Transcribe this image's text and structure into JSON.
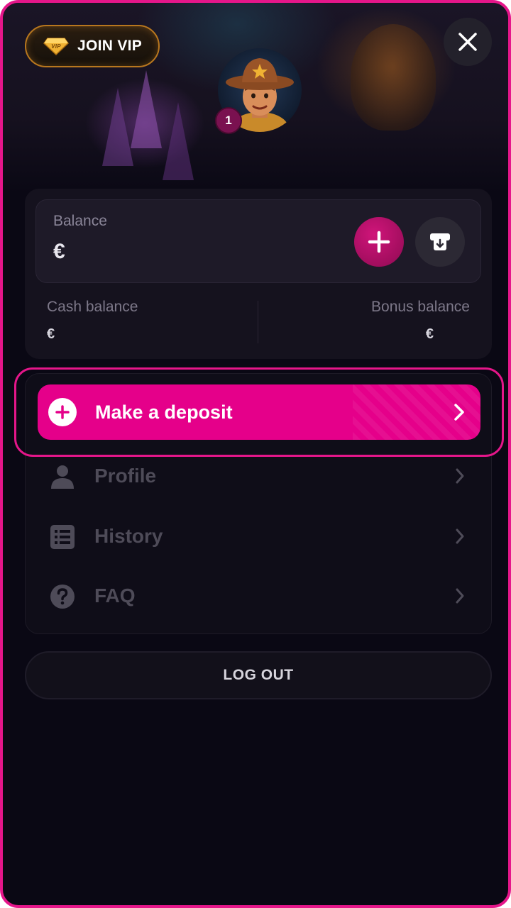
{
  "header": {
    "vip_button_label": "JOIN VIP",
    "vip_badge_text": "VIP",
    "level": "1"
  },
  "balance": {
    "label": "Balance",
    "value": "€",
    "cash_label": "Cash balance",
    "cash_value": "€",
    "bonus_label": "Bonus balance",
    "bonus_value": "€"
  },
  "menu": {
    "deposit_label": "Make a deposit",
    "items": [
      {
        "label": "Profile",
        "icon": "user-icon"
      },
      {
        "label": "History",
        "icon": "list-icon"
      },
      {
        "label": "FAQ",
        "icon": "question-icon"
      }
    ]
  },
  "logout_label": "LOG OUT",
  "colors": {
    "accent": "#e5008a",
    "highlight_border": "#e5168a",
    "background": "#0a0814",
    "vip_border": "#b8771e"
  }
}
